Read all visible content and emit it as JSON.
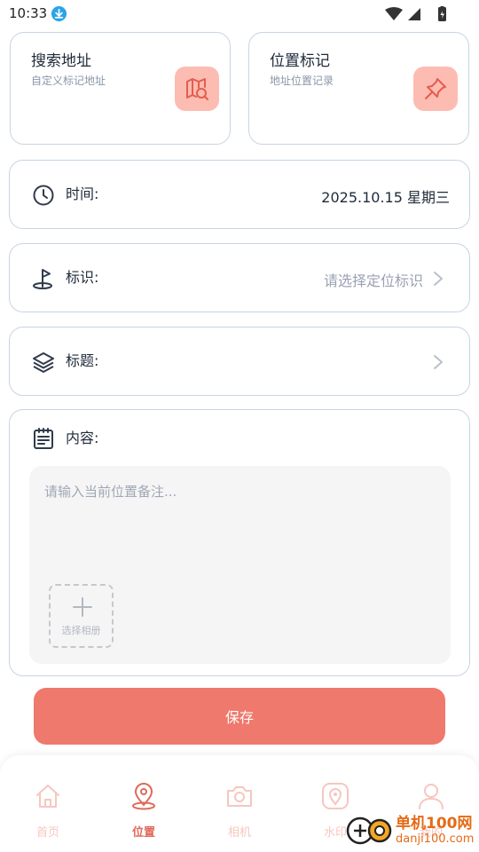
{
  "status_bar": {
    "time": "10:33"
  },
  "top_cards": {
    "search": {
      "title": "搜索地址",
      "subtitle": "自定义标记地址",
      "icon": "map-search-icon"
    },
    "mark": {
      "title": "位置标记",
      "subtitle": "地址位置记录",
      "icon": "pin-icon"
    }
  },
  "time_row": {
    "label": "时间:",
    "value": "2025.10.15  星期三",
    "icon": "clock-icon"
  },
  "tag_row": {
    "label": "标识:",
    "value": "请选择定位标识",
    "icon": "flag-marker-icon"
  },
  "title_row": {
    "label": "标题:",
    "value": "",
    "icon": "layers-icon"
  },
  "content": {
    "label": "内容:",
    "placeholder": "请输入当前位置备注...",
    "album_label": "选择相册",
    "icon": "notepad-icon"
  },
  "save_label": "保存",
  "nav": [
    {
      "label": "首页",
      "icon": "home-icon",
      "active": false
    },
    {
      "label": "位置",
      "icon": "location-icon",
      "active": true
    },
    {
      "label": "相机",
      "icon": "camera-icon",
      "active": false
    },
    {
      "label": "水印",
      "icon": "watermark-pin-icon",
      "active": false
    },
    {
      "label": "我的",
      "icon": "user-icon",
      "active": false
    }
  ],
  "watermark": {
    "title": "单机100网",
    "url": "danji100.com"
  },
  "colors": {
    "accent": "#ef796c",
    "accent_light": "#fdbcb2",
    "border": "#c9d4e1",
    "muted": "#98a2b3"
  }
}
